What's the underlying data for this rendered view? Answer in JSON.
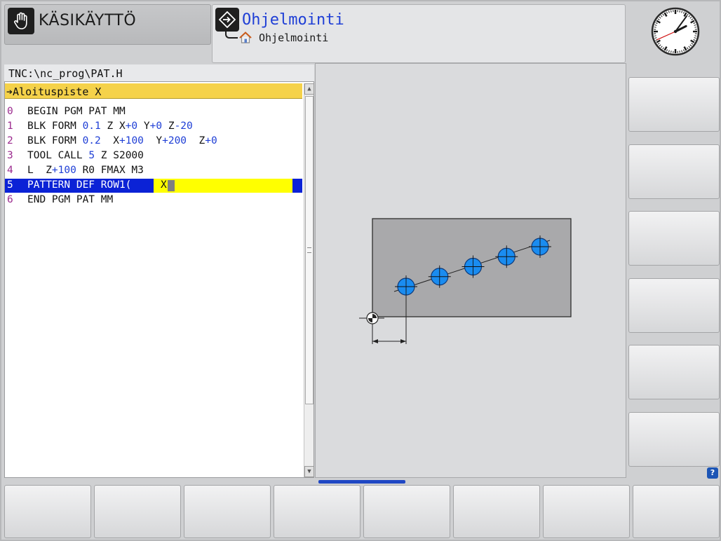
{
  "mode_tabs": {
    "manual": {
      "label": "KÄSIKÄYTTÖ",
      "icon": "hand-icon"
    },
    "programming": {
      "title": "Ohjelmointi",
      "subtitle": "Ohjelmointi",
      "icon": "program-icon"
    }
  },
  "path": "TNC:\\nc_prog\\PAT.H",
  "dialog_prompt": "➔Aloituspiste X",
  "program_lines": [
    {
      "num": "0",
      "parts": [
        {
          "t": "BEGIN PGM PAT MM",
          "c": "k"
        }
      ]
    },
    {
      "num": "1",
      "parts": [
        {
          "t": "BLK FORM ",
          "c": "k"
        },
        {
          "t": "0.1",
          "c": "b"
        },
        {
          "t": " Z X",
          "c": "k"
        },
        {
          "t": "+0",
          "c": "b"
        },
        {
          "t": " Y",
          "c": "k"
        },
        {
          "t": "+0",
          "c": "b"
        },
        {
          "t": " Z",
          "c": "k"
        },
        {
          "t": "-20",
          "c": "b"
        }
      ]
    },
    {
      "num": "2",
      "parts": [
        {
          "t": "BLK FORM ",
          "c": "k"
        },
        {
          "t": "0.2",
          "c": "b"
        },
        {
          "t": "  X",
          "c": "k"
        },
        {
          "t": "+100",
          "c": "b"
        },
        {
          "t": "  Y",
          "c": "k"
        },
        {
          "t": "+200",
          "c": "b"
        },
        {
          "t": "  Z",
          "c": "k"
        },
        {
          "t": "+0",
          "c": "b"
        }
      ]
    },
    {
      "num": "3",
      "parts": [
        {
          "t": "TOOL CALL ",
          "c": "k"
        },
        {
          "t": "5",
          "c": "b"
        },
        {
          "t": " Z S2000",
          "c": "k"
        }
      ]
    },
    {
      "num": "4",
      "parts": [
        {
          "t": "L  Z",
          "c": "k"
        },
        {
          "t": "+100",
          "c": "b"
        },
        {
          "t": " R0 FMAX M3",
          "c": "k"
        }
      ]
    },
    {
      "num": "5",
      "parts": [
        {
          "t": "PATTERN DEF ROW1(",
          "c": "k"
        }
      ],
      "active": true,
      "field": "X"
    },
    {
      "num": "6",
      "parts": [
        {
          "t": "END PGM PAT MM",
          "c": "k"
        }
      ]
    }
  ],
  "graphic": {
    "hole_count": 5
  },
  "colors": {
    "accent_blue": "#1f3fd6",
    "highlight_yellow": "#ffff00",
    "selection_blue": "#0b22d6",
    "dialog_yellow": "#f5d24a"
  },
  "clock": {
    "hour": 2,
    "minute": 6,
    "second": 41
  },
  "help_label": "?",
  "vertical_softkeys": [
    "",
    "",
    "",
    "",
    "",
    ""
  ],
  "horizontal_softkeys": [
    "",
    "",
    "",
    "",
    "",
    "",
    "",
    ""
  ]
}
